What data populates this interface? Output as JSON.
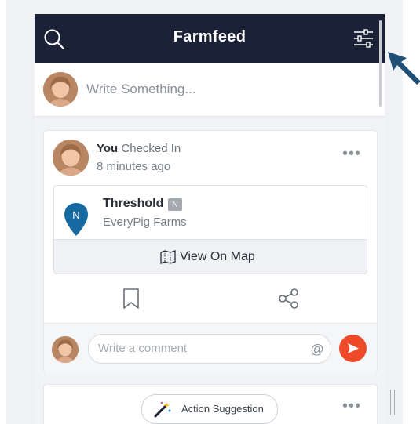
{
  "header": {
    "title": "Farmfeed"
  },
  "composer": {
    "placeholder": "Write Something..."
  },
  "post": {
    "author": "You",
    "action": "Checked In",
    "time": "8 minutes ago",
    "more_label": "•••",
    "checkin": {
      "pin_letter": "N",
      "farm_name": "Threshold",
      "badge": "N",
      "company": "EveryPig Farms",
      "map_button_label": "View On Map"
    },
    "comment": {
      "placeholder": "Write a comment",
      "at_symbol": "@"
    }
  },
  "next_card": {
    "suggestion_label": "Action Suggestion",
    "more_label": "•••"
  },
  "colors": {
    "header_bg": "#1b2136",
    "send_button": "#ee4a2a",
    "pin": "#176aa1",
    "pointer": "#1f4f75"
  },
  "icons": [
    "search-icon",
    "filter-icon",
    "bookmark-icon",
    "share-icon",
    "map-icon",
    "send-icon",
    "wand-icon",
    "pin-icon"
  ]
}
